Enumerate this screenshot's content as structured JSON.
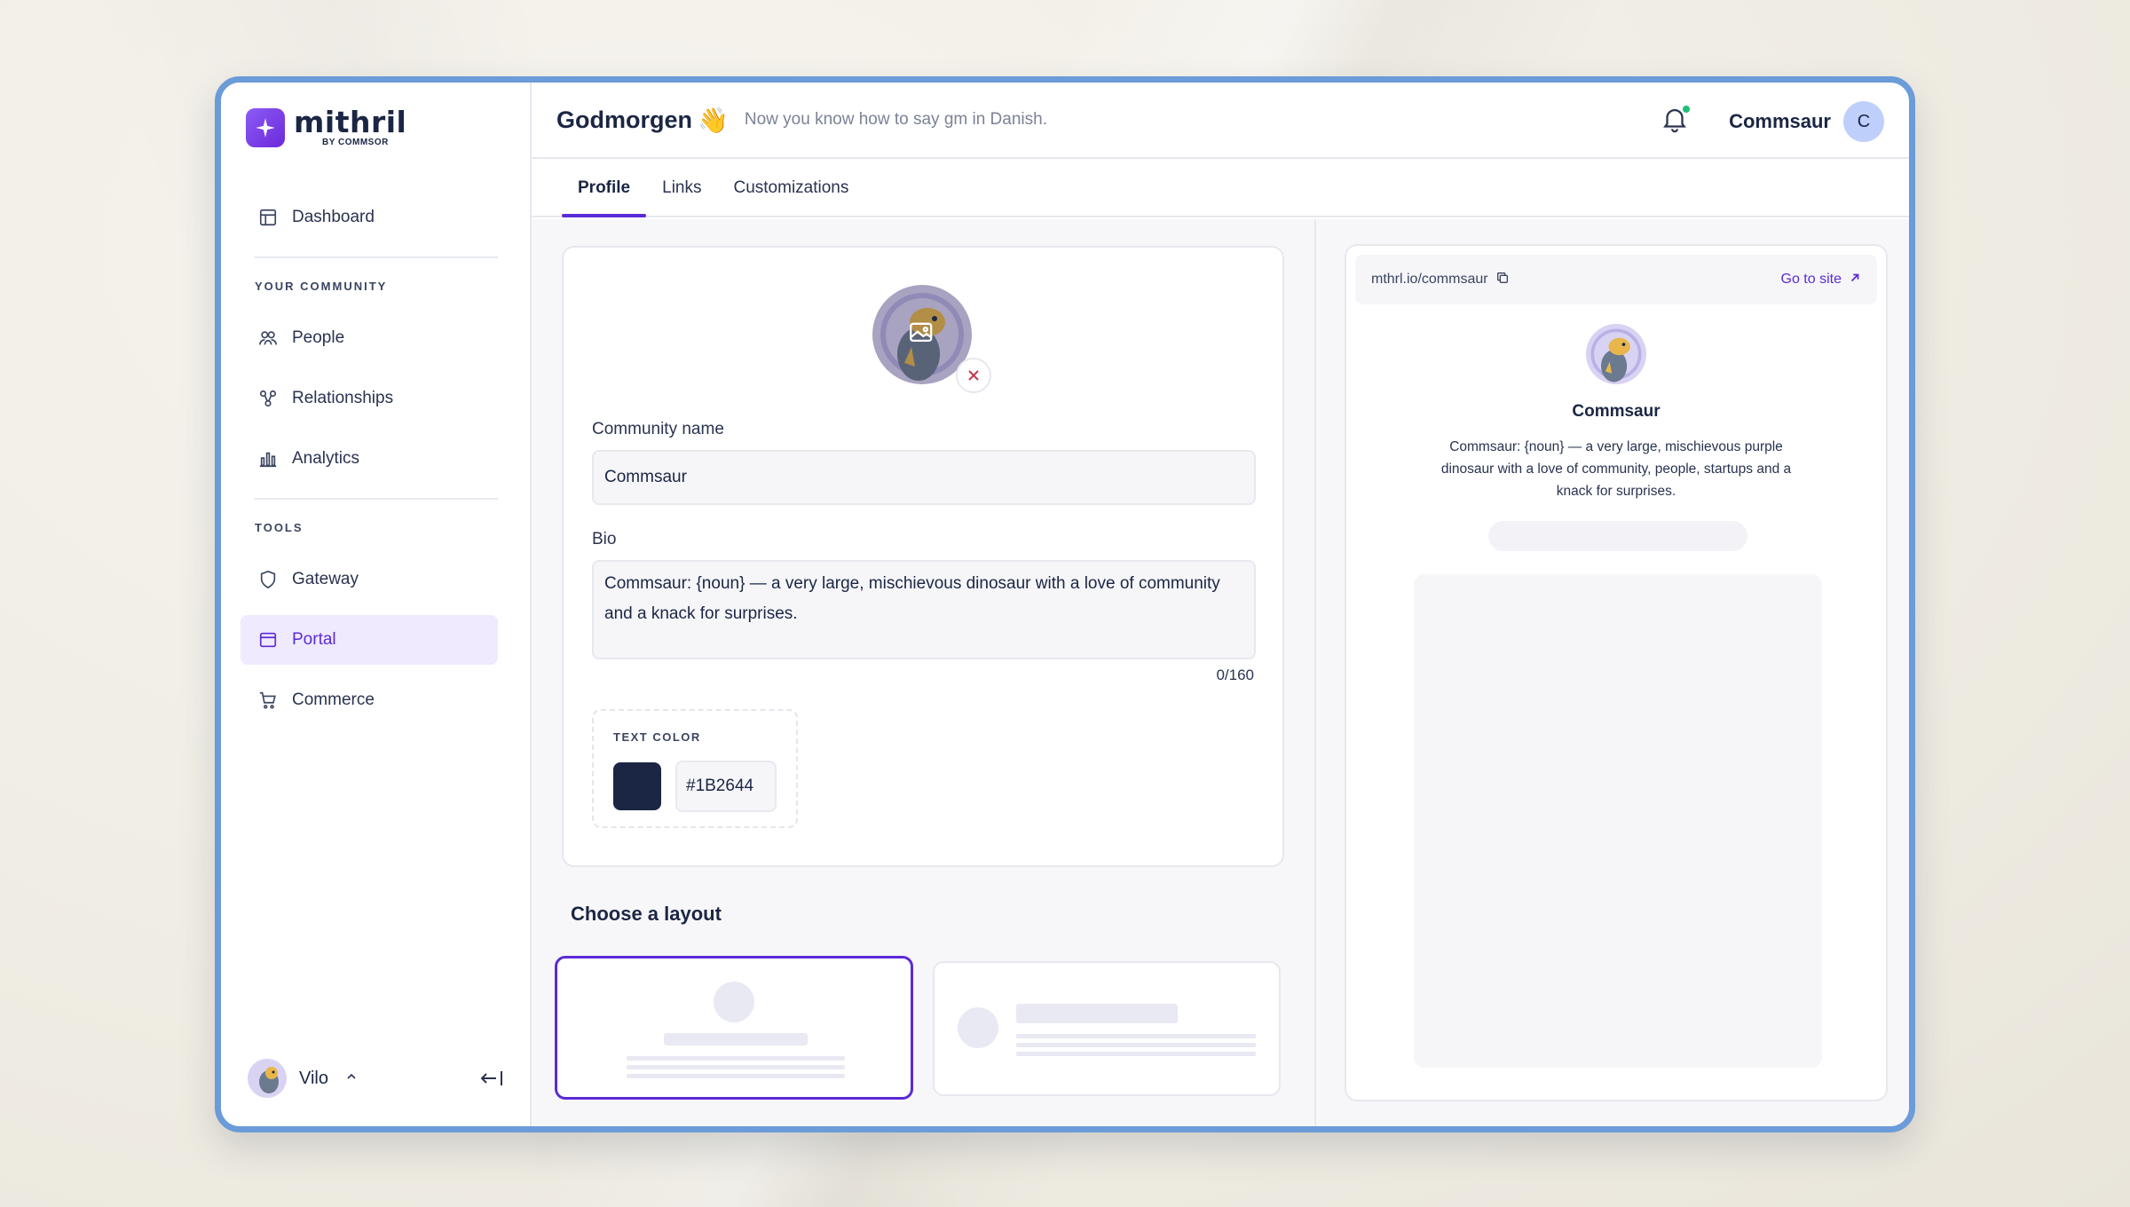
{
  "brand": {
    "name": "mithril",
    "sub": "BY COMMSOR"
  },
  "sidebar": {
    "dashboard": "Dashboard",
    "section_community": "YOUR COMMUNITY",
    "people": "People",
    "relationships": "Relationships",
    "analytics": "Analytics",
    "section_tools": "TOOLS",
    "gateway": "Gateway",
    "portal": "Portal",
    "commerce": "Commerce",
    "active_item": "Portal"
  },
  "user": {
    "name": "Vilo"
  },
  "header": {
    "title": "Godmorgen",
    "emoji": "👋",
    "subtitle": "Now you know how to say gm in Danish.",
    "user_name": "Commsaur",
    "user_initial": "C",
    "notification_dot_color": "#1fbf7a"
  },
  "tabs": [
    "Profile",
    "Links",
    "Customizations"
  ],
  "active_tab": "Profile",
  "profile_form": {
    "community_name_label": "Community name",
    "community_name_value": "Commsaur",
    "bio_label": "Bio",
    "bio_value": "Commsaur: {noun} — a very large, mischievous dinosaur with a love of community and a knack for surprises.",
    "bio_counter": "0/160",
    "text_color_label": "TEXT COLOR",
    "text_color_value": "#1B2644"
  },
  "layout_section": {
    "title": "Choose a layout",
    "selected_option": 1
  },
  "preview": {
    "url": "mthrl.io/commsaur",
    "go_to_site": "Go to site",
    "name": "Commsaur",
    "bio": "Commsaur: {noun} — a very large, mischievous purple dinosaur with a love of community, people, startups and a knack for surprises."
  },
  "colors": {
    "accent": "#5b2bd6",
    "frame_border": "#6b9bd8",
    "text_primary": "#1b2644"
  }
}
